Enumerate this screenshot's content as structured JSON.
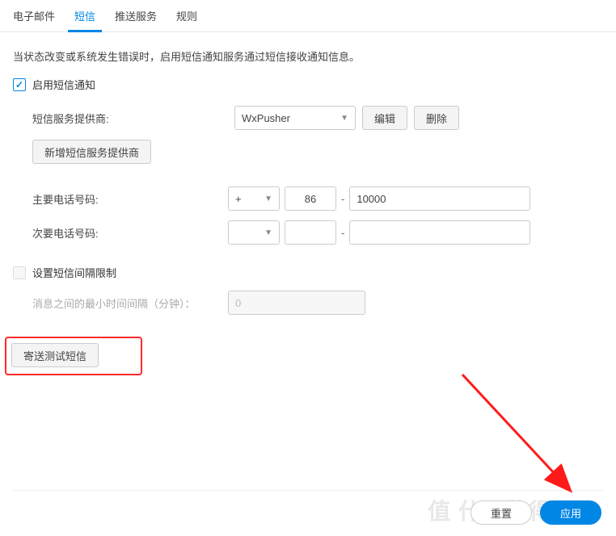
{
  "tabs": {
    "email": "电子邮件",
    "sms": "短信",
    "push": "推送服务",
    "rules": "规则"
  },
  "description": "当状态改变或系统发生错误时，启用短信通知服务通过短信接收通知信息。",
  "enable_sms_label": "启用短信通知",
  "provider": {
    "label": "短信服务提供商:",
    "value": "WxPusher",
    "edit": "编辑",
    "delete": "删除",
    "add_new": "新增短信服务提供商"
  },
  "primary_phone": {
    "label": "主要电话号码:",
    "prefix": "+",
    "country": "86",
    "number": "10000"
  },
  "secondary_phone": {
    "label": "次要电话号码:",
    "prefix": "",
    "country": "",
    "number": ""
  },
  "interval": {
    "checkbox_label": "设置短信间隔限制",
    "min_label": "消息之间的最小时间间隔（分钟）：",
    "value": "0"
  },
  "send_test": "寄送测试短信",
  "footer": {
    "reset": "重置",
    "apply": "应用"
  },
  "watermark": "值  什么值得买"
}
